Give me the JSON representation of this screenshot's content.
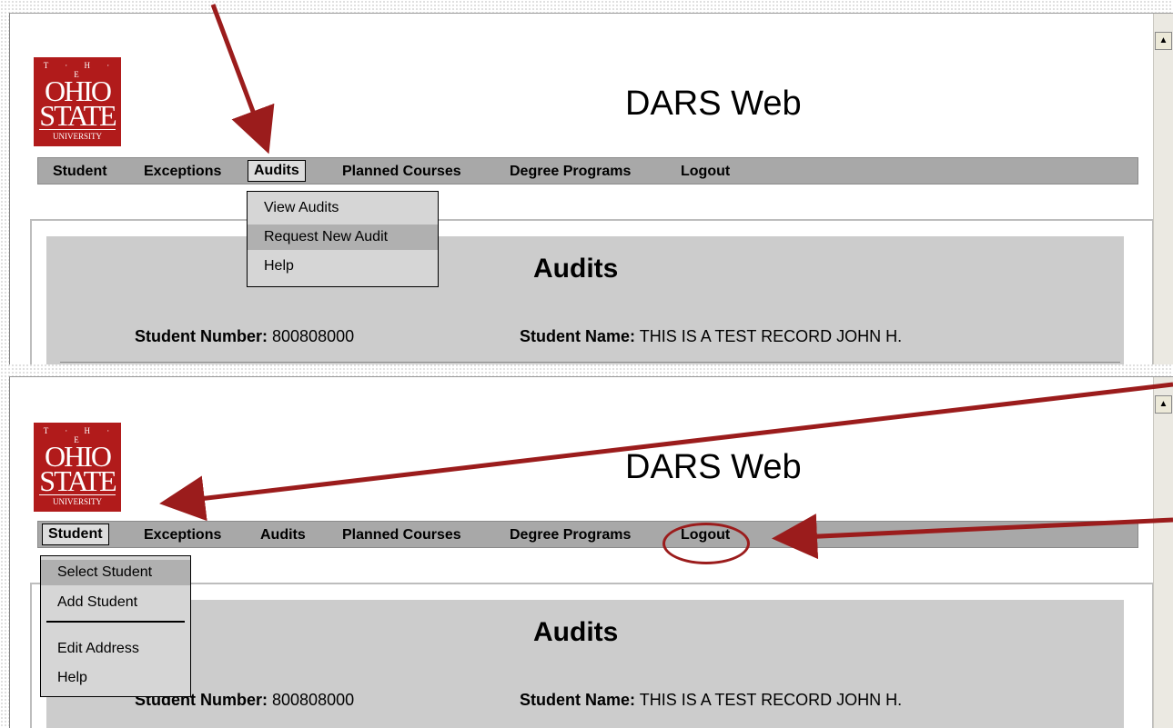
{
  "app": {
    "title": "DARS Web",
    "logo": {
      "the": "T · H · E",
      "ohio": "OHIO",
      "state": "STATE",
      "university": "UNIVERSITY"
    }
  },
  "menu": [
    "Student",
    "Exceptions",
    "Audits",
    "Planned Courses",
    "Degree Programs",
    "Logout"
  ],
  "audits_menu": {
    "items": [
      "View Audits",
      "Request New Audit",
      "Help"
    ],
    "highlighted": "Request New Audit"
  },
  "student_menu": {
    "items": [
      "Select Student",
      "Add Student",
      "Edit Address",
      "Help"
    ],
    "highlighted": "Select Student"
  },
  "section": {
    "title": "Audits",
    "student_number_label": "Student Number:",
    "student_number": "800808000",
    "student_name_label": "Student Name:",
    "student_name": "THIS IS A TEST RECORD JOHN H."
  },
  "colors": {
    "annotation": "#9b1c1c",
    "logo": "#b11b1b",
    "menubar": "#a8a8a8"
  }
}
